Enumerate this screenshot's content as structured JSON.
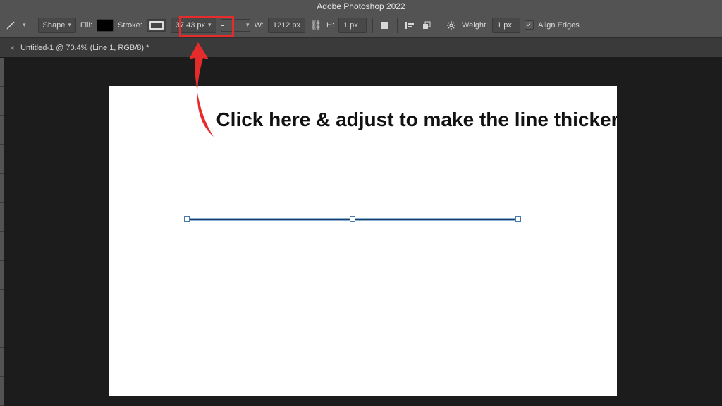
{
  "app": {
    "title": "Adobe Photoshop 2022"
  },
  "options_bar": {
    "mode_label": "Shape",
    "fill_label": "Fill:",
    "stroke_label": "Stroke:",
    "stroke_width": "37.43 px",
    "w_label": "W:",
    "w_value": "1212 px",
    "h_label": "H:",
    "h_value": "1 px",
    "weight_label": "Weight:",
    "weight_value": "1 px",
    "align_edges_label": "Align Edges"
  },
  "tabs": {
    "doc_title": "Untitled-1 @ 70.4% (Line 1, RGB/8) *"
  },
  "annotation": {
    "text": "Click here & adjust to make the line thicker",
    "highlight_color": "#e62b2b"
  }
}
